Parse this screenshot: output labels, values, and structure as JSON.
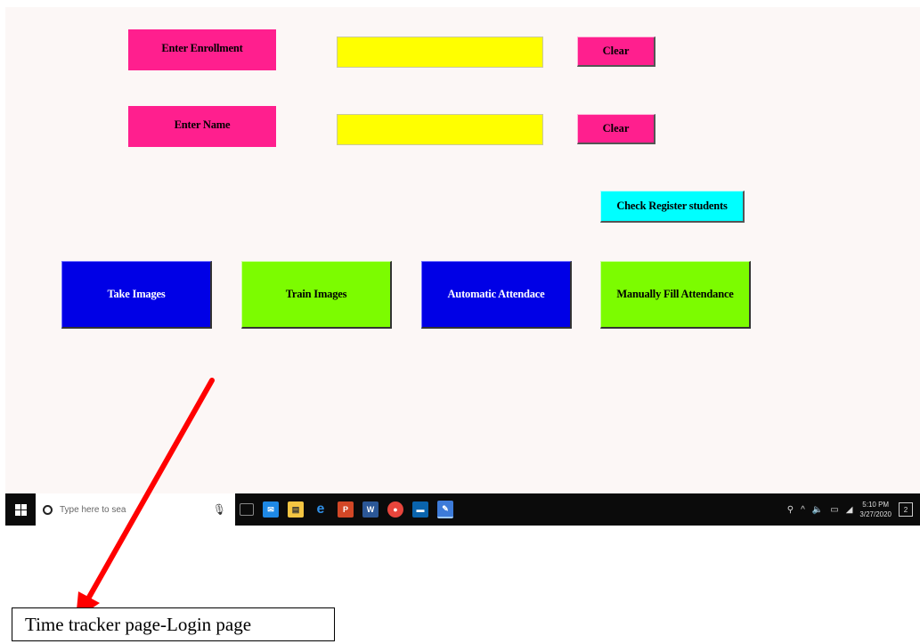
{
  "form": {
    "enrollment_label": "Enter Enrollment",
    "enrollment_value": "",
    "name_label": "Enter Name",
    "name_value": "",
    "clear_enrollment": "Clear",
    "clear_name": "Clear",
    "check_register": "Check Register students"
  },
  "actions": {
    "take_images": "Take Images",
    "train_images": "Train Images",
    "automatic_attendance": "Automatic Attendace",
    "manual_attendance": "Manually Fill Attendance"
  },
  "taskbar": {
    "search_placeholder": "Type here to search",
    "search_visible": "Type here to sea",
    "time": "5:10 PM",
    "date": "3/27/2020",
    "notification_count": "2",
    "pinned_icons": [
      "task-view-icon",
      "mail-icon",
      "file-explorer-icon",
      "edge-icon",
      "powerpoint-icon",
      "word-icon",
      "chrome-icon",
      "outlook-icon",
      "python-app-icon"
    ]
  },
  "annotation": {
    "caption": "Time tracker page-Login page",
    "arrow_color": "#ff0000"
  },
  "colors": {
    "label_pink": "#ff1f8e",
    "field_yellow": "#ffff00",
    "check_cyan": "#00ffff",
    "action_blue": "#0000e6",
    "action_green": "#7cfc00",
    "background": "#fcf7f6"
  }
}
